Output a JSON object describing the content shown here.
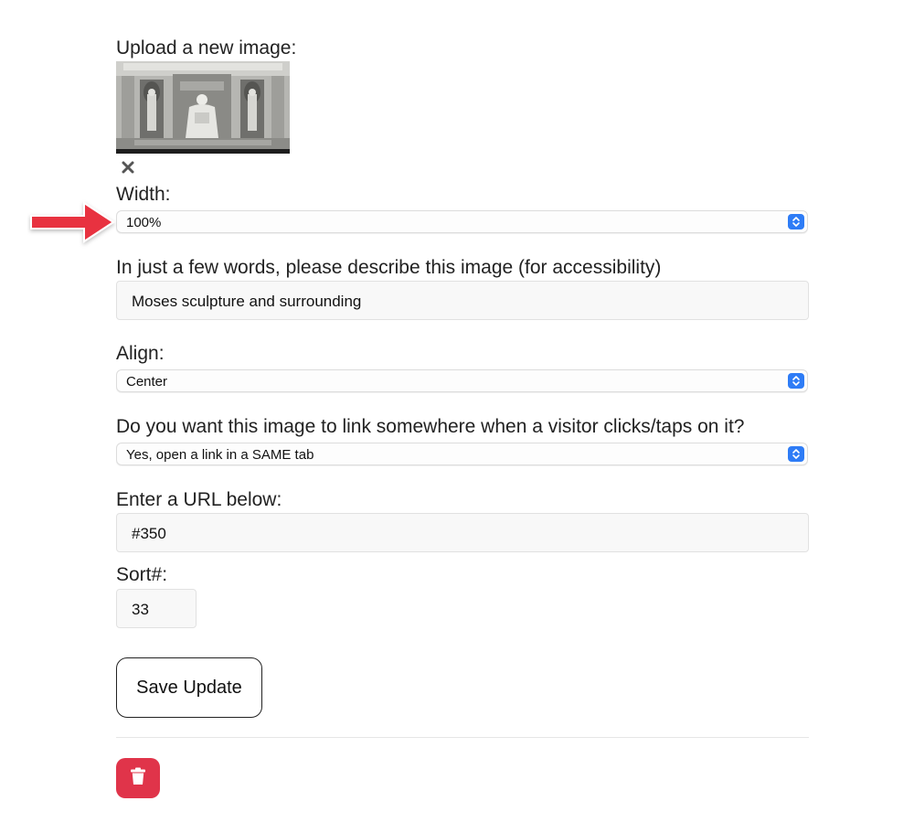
{
  "upload": {
    "label": "Upload a new image:",
    "remove_icon": "close-x-icon"
  },
  "width": {
    "label": "Width:",
    "selected": "100%"
  },
  "description": {
    "label": "In just a few words, please describe this image (for accessibility)",
    "value": "Moses sculpture and surrounding"
  },
  "align": {
    "label": "Align:",
    "selected": "Center"
  },
  "link": {
    "label": "Do you want this image to link somewhere when a visitor clicks/taps on it?",
    "selected": "Yes, open a link in a SAME tab"
  },
  "url": {
    "label": "Enter a URL below:",
    "value": "#350"
  },
  "sort": {
    "label": "Sort#:",
    "value": "33"
  },
  "actions": {
    "save_label": "Save Update",
    "delete_icon": "trash-icon"
  },
  "colors": {
    "accent_blue": "#2e7cf6",
    "delete_red": "#e0344a",
    "annotation_arrow": "#e8303f"
  }
}
